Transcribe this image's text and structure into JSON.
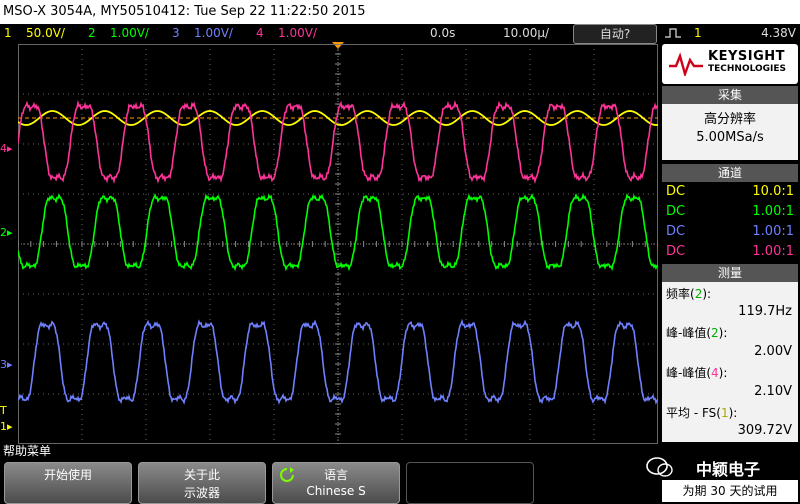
{
  "title": "MSO-X 3054A, MY50510412: Tue Sep 22 11:22:50 2015",
  "channels": [
    {
      "num": "1",
      "scale": "50.0V/",
      "color": "#ffff00"
    },
    {
      "num": "2",
      "scale": "1.00V/",
      "color": "#00ff00"
    },
    {
      "num": "3",
      "scale": "1.00V/",
      "color": "#6f80ff"
    },
    {
      "num": "4",
      "scale": "1.00V/",
      "color": "#ff3399"
    }
  ],
  "timebase": {
    "delay": "0.0s",
    "scale": "10.00µ/"
  },
  "run_mode": "自动?",
  "trigger": {
    "source": "1",
    "level": "4.38V"
  },
  "logo": {
    "brand": "KEYSIGHT",
    "sub": "TECHNOLOGIES"
  },
  "acquisition": {
    "header": "采集",
    "mode": "高分辨率",
    "rate": "5.00MSa/s"
  },
  "channel_panel": {
    "header": "通道",
    "rows": [
      {
        "coupling": "DC",
        "ratio": "10.0:1",
        "color": "#ffff00"
      },
      {
        "coupling": "DC",
        "ratio": "1.00:1",
        "color": "#00ff00"
      },
      {
        "coupling": "DC",
        "ratio": "1.00:1",
        "color": "#6f80ff"
      },
      {
        "coupling": "DC",
        "ratio": "1.00:1",
        "color": "#ff3399"
      }
    ]
  },
  "measurements": {
    "header": "测量",
    "items": [
      {
        "label": "频率",
        "src": "2",
        "value": "119.7Hz",
        "color": "#00aa00"
      },
      {
        "label": "峰-峰值",
        "src": "2",
        "value": "2.00V",
        "color": "#00aa00"
      },
      {
        "label": "峰-峰值",
        "src": "4",
        "value": "2.10V",
        "color": "#ff3399"
      },
      {
        "label": "平均 - FS",
        "src": "1",
        "value": "309.72V",
        "color": "#aaaa00"
      }
    ]
  },
  "softkeys": {
    "menu_title": "帮助菜单",
    "keys": [
      {
        "l1": "开始使用",
        "l2": ""
      },
      {
        "l1": "关于此",
        "l2": "示波器"
      },
      {
        "l1": "语言",
        "l2": "Chinese S"
      }
    ]
  },
  "watermark": "中颖电子",
  "trial": "为期 30 天的试用",
  "markers": {
    "ch4": "4",
    "ch2": "2",
    "ch3": "3",
    "ch1": "1",
    "trig": "T"
  }
}
